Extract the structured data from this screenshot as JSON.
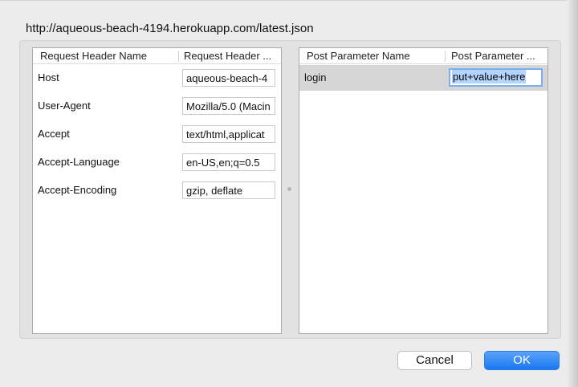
{
  "url": "http://aqueous-beach-4194.herokuapp.com/latest.json",
  "headers_table": {
    "columns": [
      "Request Header Name",
      "Request Header ..."
    ],
    "rows": [
      {
        "name": "Host",
        "value": "aqueous-beach-4"
      },
      {
        "name": "User-Agent",
        "value": "Mozilla/5.0 (Macin"
      },
      {
        "name": "Accept",
        "value": "text/html,applicat"
      },
      {
        "name": "Accept-Language",
        "value": "en-US,en;q=0.5"
      },
      {
        "name": "Accept-Encoding",
        "value": "gzip, deflate"
      }
    ]
  },
  "post_table": {
    "columns": [
      "Post Parameter Name",
      "Post Parameter ..."
    ],
    "rows": [
      {
        "name": "login",
        "value": "put+value+here"
      }
    ]
  },
  "buttons": {
    "cancel": "Cancel",
    "ok": "OK"
  },
  "colors": {
    "accent": "#1b77f0",
    "selected_row": "#d6d6d6",
    "selection": "#b3d4fc"
  }
}
